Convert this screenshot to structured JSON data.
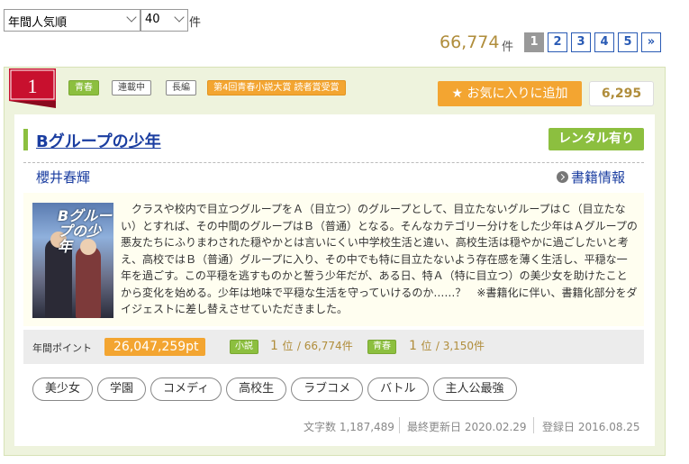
{
  "controls": {
    "sort_value": "年間人気順",
    "per_page_value": "40",
    "per_page_unit": "件"
  },
  "results": {
    "count": "66,774",
    "unit": "件"
  },
  "pagination": {
    "pages": [
      "1",
      "2",
      "3",
      "4",
      "5"
    ],
    "next": "»",
    "current": "1"
  },
  "item": {
    "rank": "1",
    "tags": [
      "青春",
      "連載中",
      "長編",
      "第4回青春小説大賞 読者賞受賞"
    ],
    "favorite_label": "お気に入りに追加",
    "favorite_count": "6,295",
    "title": "Bグループの少年",
    "rental_label": "レンタル有り",
    "author": "櫻井春輝",
    "book_info_label": "書籍情報",
    "cover_text": "Bグループの少年",
    "synopsis": "　クラスや校内で目立つグループをＡ（目立つ）のグループとして、目立たないグループはＣ（目立たない）とすれば、その中間のグループはＢ（普通）となる。そんなカテゴリー分けをした少年はＡグループの悪友たちにふりまわされた穏やかとは言いにくい中学校生活と違い、高校生活は穏やかに過ごしたいと考え、高校ではＢ（普通）グループに入り、その中でも特に目立たないよう存在感を薄く生活し、平穏な一年を過ごす。この平穏を逃すものかと誓う少年だが、ある日、特Ａ（特に目立つ）の美少女を助けたことから変化を始める。少年は地味で平穏な生活を守っていけるのか……？　※書籍化に伴い、書籍化部分をダイジェストに差し替えさせていただきました。",
    "points_label": "年間ポイント",
    "points_value": "26,047,259pt",
    "rank_novel_label": "小説",
    "rank_novel_pos": "1",
    "rank_novel_unit": "位",
    "rank_novel_total": "/ 66,774件",
    "rank_genre_label": "青春",
    "rank_genre_pos": "1",
    "rank_genre_unit": "位",
    "rank_genre_total": "/ 3,150件",
    "keywords": [
      "美少女",
      "学園",
      "コメディ",
      "高校生",
      "ラブコメ",
      "バトル",
      "主人公最強"
    ],
    "char_count_label": "文字数",
    "char_count": "1,187,489",
    "updated_label": "最終更新日",
    "updated": "2020.02.29",
    "registered_label": "登録日",
    "registered": "2016.08.25"
  },
  "colors": {
    "accent_green": "#8cbf3f",
    "accent_orange": "#f3a531",
    "link_blue": "#1a3da0",
    "rank_red": "#c8102e"
  },
  "icons": {
    "favorite": "star-icon",
    "book_info": "arrow-circle-icon",
    "select": "chevron-down-icon"
  }
}
